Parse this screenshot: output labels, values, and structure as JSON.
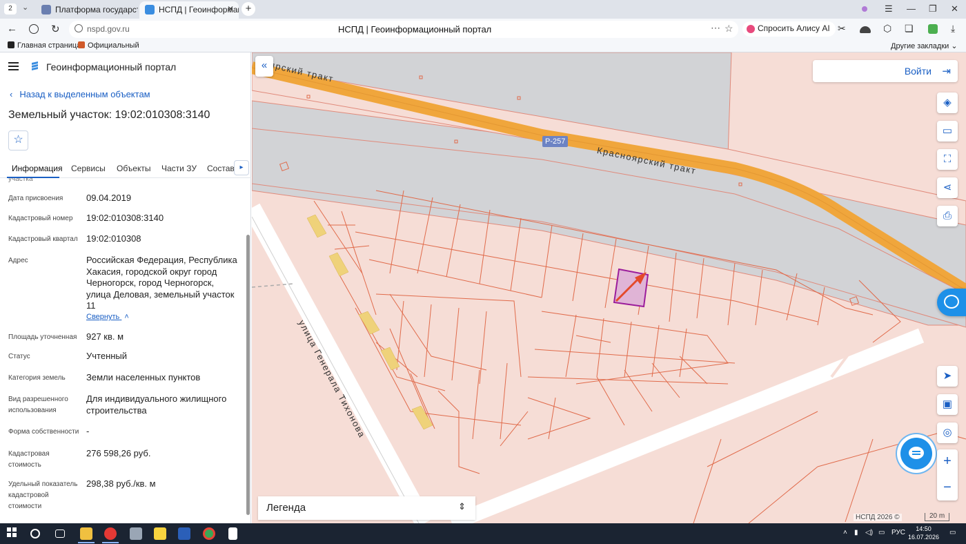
{
  "browser": {
    "tab_count": "2",
    "tabs": [
      {
        "title": "Платформа государственн"
      },
      {
        "title": "НСПД | Геоинформацио"
      }
    ],
    "url": "nspd.gov.ru",
    "page_title": "НСПД | Геоинформационный портал",
    "alice_label": "Спросить Алису AI",
    "bookmarks": [
      "Главная страница",
      "Официальный са"
    ],
    "other_bookmarks": "Другие закладки"
  },
  "panel": {
    "portal_title": "Геоинформационный портал",
    "back_link": "Назад к выделенным объектам",
    "object_title": "Земельный участок: 19:02:010308:3140",
    "tabs": [
      "Информация",
      "Сервисы",
      "Объекты",
      "Части ЗУ",
      "Состав"
    ],
    "cut_label": "участка",
    "properties": [
      {
        "label": "Дата присвоения",
        "value": "09.04.2019"
      },
      {
        "label": "Кадастровый номер",
        "value": "19:02:010308:3140"
      },
      {
        "label": "Кадастровый квартал",
        "value": "19:02:010308"
      },
      {
        "label": "Адрес",
        "value": "Российская Федерация, Республика Хакасия, городской округ город Черногорск, город Черногорск, улица Деловая, земельный участок 11"
      },
      {
        "label": "Площадь уточненная",
        "value": "927 кв. м"
      },
      {
        "label": "Статус",
        "value": "Учтенный"
      },
      {
        "label": "Категория земель",
        "value": "Земли населенных пунктов"
      },
      {
        "label": "Вид разрешенного использования",
        "value": "Для индивидуального жилищного строительства"
      },
      {
        "label": "Форма собственности",
        "value": "-"
      },
      {
        "label": "Кадастровая стоимость",
        "value": "276 598,26 руб."
      },
      {
        "label": "Удельный показатель кадастровой стоимости",
        "value": "298,38 руб./кв. м"
      }
    ],
    "collapse_label": "Свернуть"
  },
  "map": {
    "road_label": "Красноярский тракт",
    "road_label_top": "ярский тракт",
    "road_badge": "Р-257",
    "street_label": "улица Генерала Тихонова",
    "login_label": "Войти",
    "legend_label": "Легенда",
    "copyright": "НСПД 2026 ©",
    "scale": "20 m",
    "colors": {
      "parcel_fill": "#f6ddd6",
      "road": "#f0a63c",
      "selected": "#9b1c9b",
      "accent": "#1a5fc4"
    }
  },
  "taskbar": {
    "lang": "РУС",
    "time": "14:50",
    "date": "16.07.2026"
  }
}
